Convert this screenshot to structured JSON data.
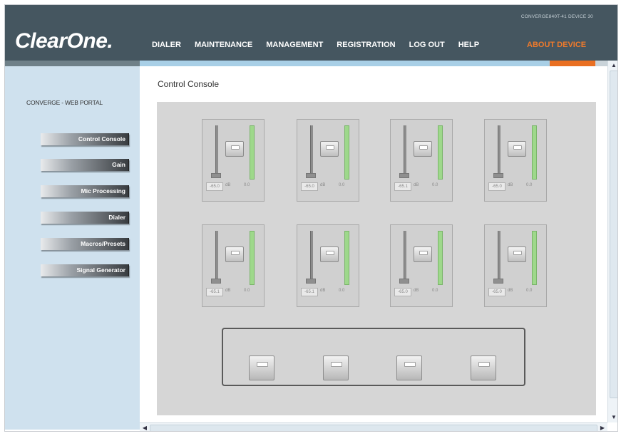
{
  "header": {
    "logo": "ClearOne.",
    "device_id": "CONVERGE840T-41 DEVICE 30",
    "nav": [
      "DIALER",
      "MAINTENANCE",
      "MANAGEMENT",
      "REGISTRATION",
      "LOG OUT",
      "HELP"
    ],
    "about": "ABOUT DEVICE",
    "accent_color": "#e96f22"
  },
  "sidebar": {
    "title": "CONVERGE - WEB PORTAL",
    "buttons": [
      "Control Console",
      "Gain",
      "Mic Processing",
      "Dialer",
      "Macros/Presets",
      "Signal Generator"
    ]
  },
  "content": {
    "title": "Control Console",
    "channels": [
      {
        "level": "-65.0",
        "unit": "dB",
        "meter": "0.0"
      },
      {
        "level": "-65.0",
        "unit": "dB",
        "meter": "0.0"
      },
      {
        "level": "-65.1",
        "unit": "dB",
        "meter": "0.0"
      },
      {
        "level": "-65.0",
        "unit": "dB",
        "meter": "0.0"
      },
      {
        "level": "-65.1",
        "unit": "dB",
        "meter": "0.0"
      },
      {
        "level": "-65.1",
        "unit": "dB",
        "meter": "0.0"
      },
      {
        "level": "-65.0",
        "unit": "dB",
        "meter": "0.0"
      },
      {
        "level": "-65.0",
        "unit": "dB",
        "meter": "0.0"
      }
    ]
  }
}
